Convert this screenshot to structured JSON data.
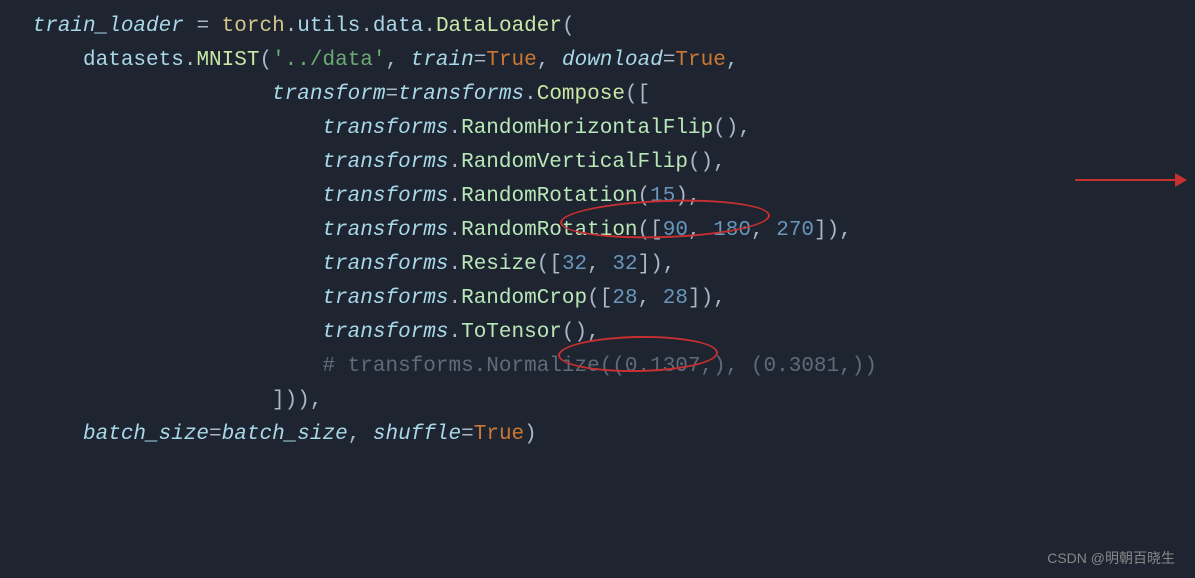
{
  "code": {
    "l1": {
      "var": "train_loader",
      "torch": "torch",
      "utils": "utils",
      "data": "data",
      "loader": "DataLoader"
    },
    "l2": {
      "datasets": "datasets",
      "mnist": "MNIST",
      "path": "'../data'",
      "train": "train",
      "tval": "True",
      "download": "download",
      "dval": "True"
    },
    "l3": {
      "transform": "transform",
      "transforms": "transforms",
      "compose": "Compose"
    },
    "l4": {
      "transforms": "transforms",
      "method": "RandomHorizontalFlip"
    },
    "l5": {
      "transforms": "transforms",
      "method": "RandomVerticalFlip"
    },
    "l6": {
      "transforms": "transforms",
      "method": "RandomRotation",
      "arg": "15"
    },
    "l7": {
      "transforms": "transforms",
      "method": "RandomRotation",
      "a1": "90",
      "a2": "180",
      "a3": "270"
    },
    "l8": {
      "transforms": "transforms",
      "method": "Resize",
      "a1": "32",
      "a2": "32"
    },
    "l9": {
      "transforms": "transforms",
      "method": "RandomCrop",
      "a1": "28",
      "a2": "28"
    },
    "l10": {
      "transforms": "transforms",
      "method": "ToTensor"
    },
    "l11": {
      "comment": "# transforms.Normalize((0.1307,), (0.3081,))"
    },
    "l12": {
      "close": "])),"
    },
    "l13": {
      "bs": "batch_size",
      "bsval": "batch_size",
      "shuffle": "shuffle",
      "sval": "True"
    }
  },
  "watermark": "CSDN @明朝百晓生"
}
